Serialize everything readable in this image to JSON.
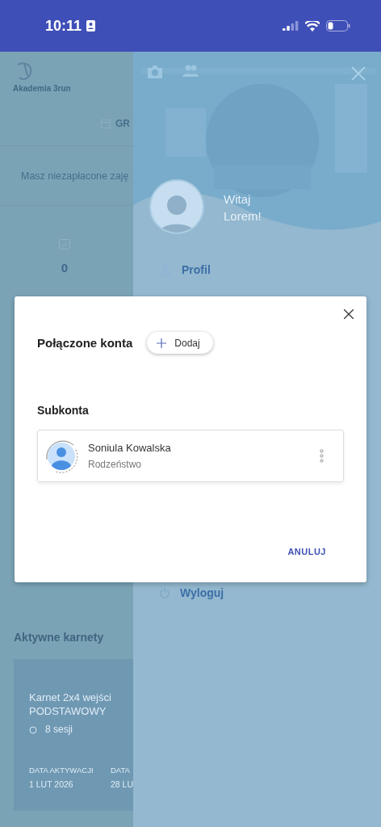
{
  "status_bar": {
    "time": "10:11"
  },
  "background_page": {
    "logo": "Akademia 3run",
    "tab_label": "GR",
    "notice": "Masz niezapłacone zaję",
    "stat_value": "0",
    "section_title": "Aktywne karnety",
    "pass": {
      "title": "Karnet 2x4 wejści",
      "subtitle": "PODSTAWOWY",
      "sessions": "8 sesji",
      "fields": [
        {
          "label": "DATA AKTYWACJI",
          "value": "1 LUT 2026"
        },
        {
          "label": "DATA",
          "value": "28 LU"
        }
      ]
    }
  },
  "drawer": {
    "greeting": [
      "Witaj",
      "Lorem!"
    ],
    "menu": [
      {
        "kind": "profile",
        "label": "Profil"
      },
      {
        "kind": "logout",
        "label": "Wyloguj"
      }
    ]
  },
  "dialog": {
    "title": "Połączone konta",
    "add_button": "Dodaj",
    "section_title": "Subkonta",
    "accounts": [
      {
        "name": "Soniula Kowalska",
        "relation": "Rodzeństwo"
      }
    ],
    "cancel_button": "ANULUJ"
  }
}
